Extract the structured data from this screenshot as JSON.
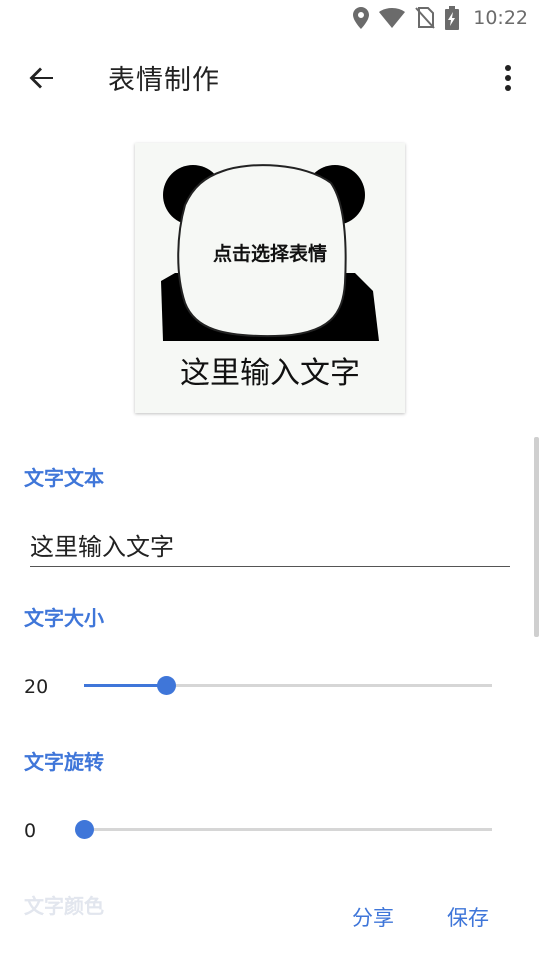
{
  "status_bar": {
    "time": "10:22",
    "icons": [
      "location-icon",
      "wifi-icon",
      "no-sim-icon",
      "battery-charging-icon"
    ]
  },
  "app_bar": {
    "title": "表情制作",
    "back_icon": "arrow-left-icon",
    "more_icon": "more-vert-icon"
  },
  "meme": {
    "hint": "点击选择表情",
    "caption": "这里输入文字"
  },
  "form": {
    "text_label": "文字文本",
    "text_value": "这里输入文字",
    "size_label": "文字大小",
    "size_value": "20",
    "size_fraction": 0.2,
    "rotation_label": "文字旋转",
    "rotation_value": "0",
    "rotation_fraction": 0,
    "color_label": "文字颜色"
  },
  "actions": {
    "share": "分享",
    "save": "保存"
  },
  "colors": {
    "accent": "#3f76d9",
    "track": "#d6d6d6"
  }
}
